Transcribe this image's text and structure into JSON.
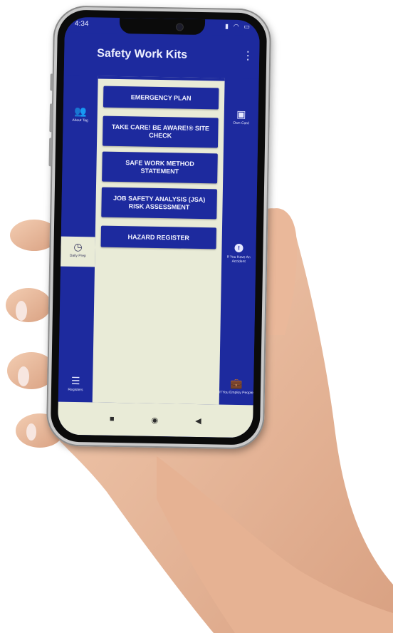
{
  "colors": {
    "primary": "#1d2a9e",
    "surface": "#e9ebd7",
    "text_on_primary": "#f2f3ff",
    "skin": "#f0c4a6"
  },
  "status_bar": {
    "time": "4:34",
    "icons": [
      "signal-icon",
      "wifi-icon",
      "battery-icon"
    ]
  },
  "app_bar": {
    "title": "Safety Work Kits",
    "menu_icon": "more-vert-icon",
    "menu_glyph": "⋮"
  },
  "left_rail": [
    {
      "icon": "people-icon",
      "glyph": "👥",
      "label": "About Tag"
    },
    {
      "icon": "clock-icon",
      "glyph": "◷",
      "label": "Daily Prep",
      "active": true
    },
    {
      "icon": "list-icon",
      "glyph": "☰",
      "label": "Registers"
    }
  ],
  "right_rail": [
    {
      "icon": "id-card-icon",
      "glyph": "▣",
      "label": "Own Card"
    },
    {
      "icon": "alert-icon",
      "glyph": "!",
      "label": "If You Have An Accident"
    },
    {
      "icon": "briefcase-icon",
      "glyph": "💼",
      "label": "If You Employ People"
    }
  ],
  "menu_buttons": [
    {
      "label": "EMERGENCY PLAN"
    },
    {
      "label": "TAKE CARE! BE AWARE!® SITE CHECK"
    },
    {
      "label": "SAFE WORK METHOD STATEMENT"
    },
    {
      "label": "JOB SAFETY ANALYSIS (JSA) RISK ASSESSMENT"
    },
    {
      "label": "HAZARD REGISTER"
    }
  ],
  "nav_bar": {
    "recents_glyph": "■",
    "home_glyph": "◉",
    "back_glyph": "◀"
  }
}
